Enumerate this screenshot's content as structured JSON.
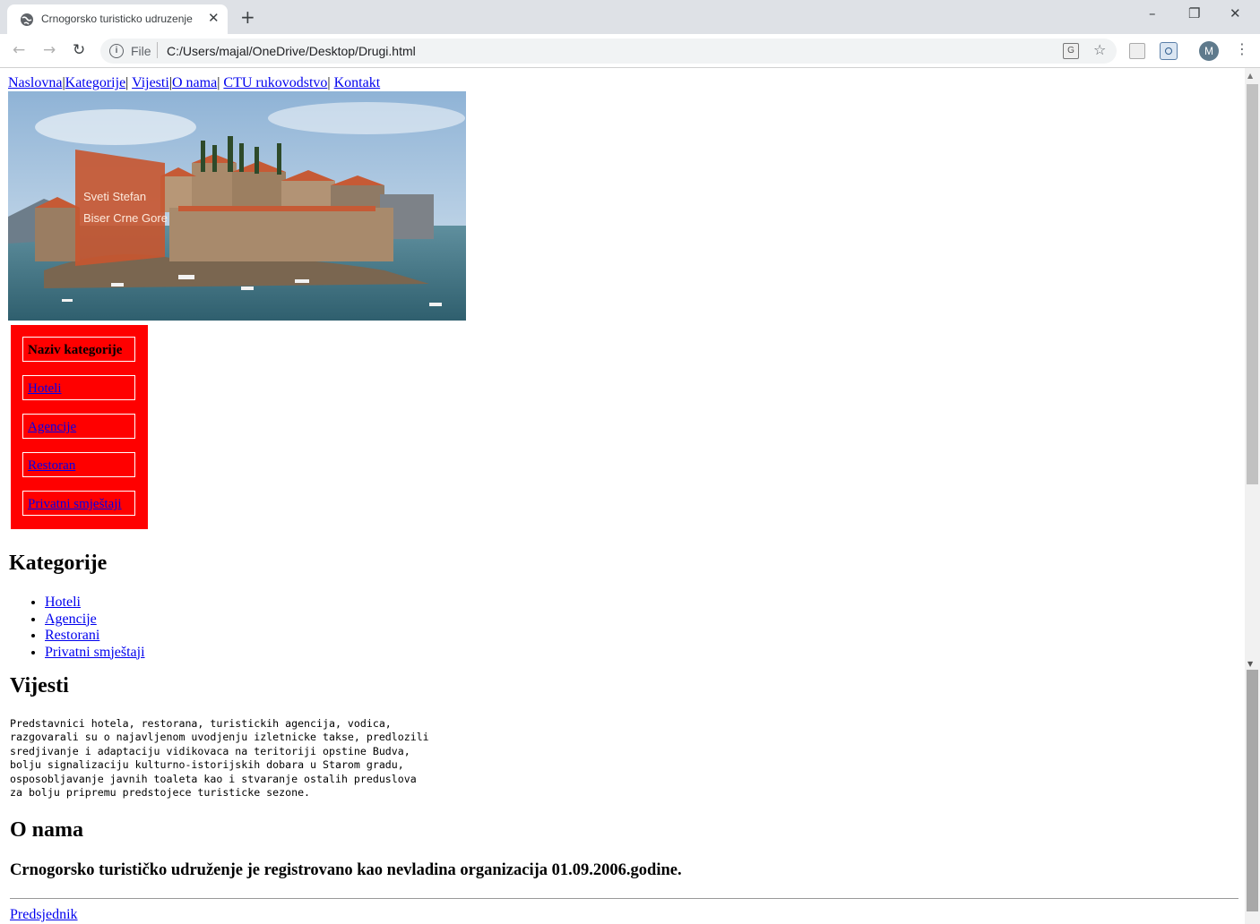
{
  "browser": {
    "tab_title": "Crnogorsko turisticko udruzenje",
    "tab_close": "✕",
    "new_tab": "+",
    "url_scheme": "File",
    "url": "C:/Users/majal/OneDrive/Desktop/Drugi.html",
    "profile_initial": "M",
    "window": {
      "minimize": "–",
      "restore": "❐",
      "close": "✕"
    }
  },
  "nav": {
    "items": [
      {
        "label": "Naslovna",
        "sep": "|"
      },
      {
        "label": "Kategorije",
        "sep": "| "
      },
      {
        "label": "Vijesti",
        "sep": "|"
      },
      {
        "label": "O nama",
        "sep": "| "
      },
      {
        "label": "CTU rukovodstvo",
        "sep": "| "
      },
      {
        "label": "Kontakt",
        "sep": ""
      }
    ]
  },
  "hero": {
    "caption_line1": "Sveti Stefan",
    "caption_line2": "Biser Crne Gore"
  },
  "category_table": {
    "header": "Naziv kategorije",
    "items": [
      "Hoteli",
      "Agencije",
      "Restoran",
      "Privatni smještaji"
    ]
  },
  "categories": {
    "title": "Kategorije",
    "items": [
      "Hoteli",
      "Agencije",
      "Restorani",
      "Privatni smještaji"
    ]
  },
  "news": {
    "title": "Vijesti",
    "text": "Predstavnici hotela, restorana, turistickih agencija, vodica,\nrazgovarali su o najavljenom uvodjenju izletnicke takse, predlozili\nsredjivanje i adaptaciju vidikovaca na teritoriji opstine Budva,\nbolju signalizaciju kulturno-istorijskih dobara u Starom gradu,\nosposobljavanje javnih toaleta kao i stvaranje ostalih preduslova\nza bolju pripremu predstojece turisticke sezone."
  },
  "about": {
    "title": "O nama",
    "text": "Crnogorsko turističko udruženje je registrovano kao nevladina organizacija 01.09.2006.godine."
  },
  "footer": {
    "president_link": "Predsjednik"
  }
}
